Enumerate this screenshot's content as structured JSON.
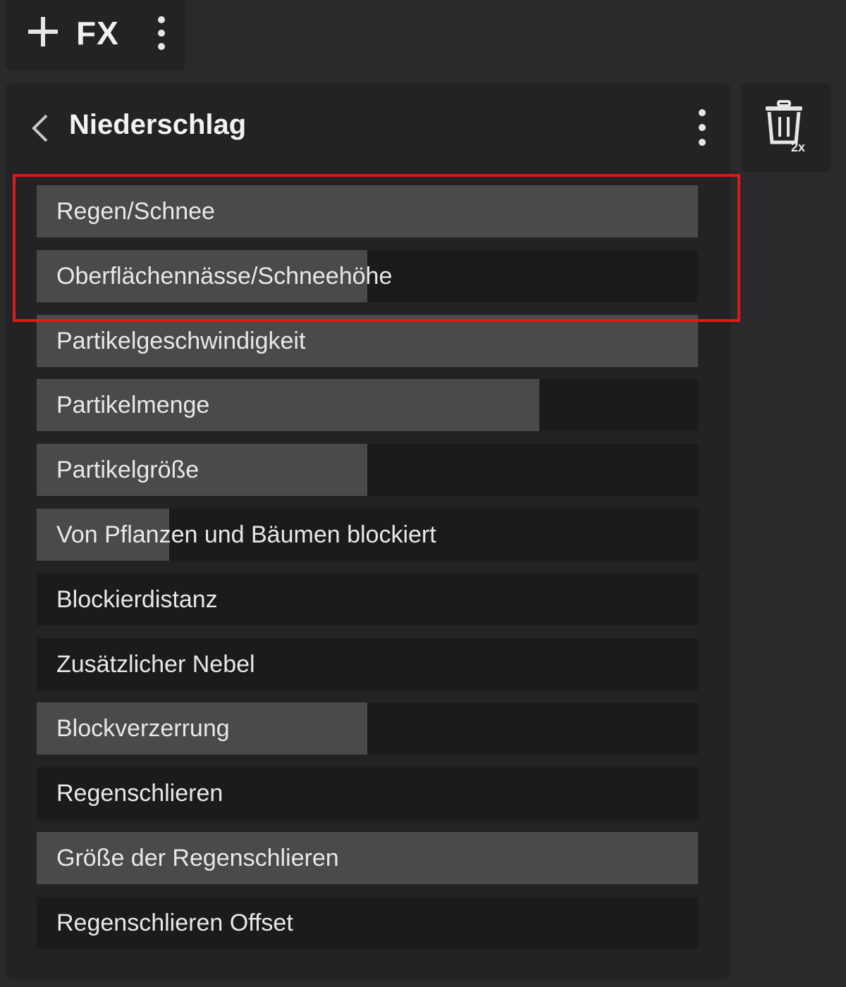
{
  "toolbar": {
    "fx_label": "FX",
    "add_icon": "plus-icon",
    "more_icon": "more-vertical-icon"
  },
  "panel": {
    "title": "Niederschlag",
    "back_icon": "chevron-left-icon",
    "more_icon": "more-vertical-icon"
  },
  "trash": {
    "icon": "trash-icon",
    "badge": "2x"
  },
  "sliders": [
    {
      "label": "Regen/Schnee",
      "fill_pct": 100
    },
    {
      "label": "Oberflächennässe/Schneehöhe",
      "fill_pct": 50
    },
    {
      "label": "Partikelgeschwindigkeit",
      "fill_pct": 100
    },
    {
      "label": "Partikelmenge",
      "fill_pct": 76
    },
    {
      "label": "Partikelgröße",
      "fill_pct": 50
    },
    {
      "label": "Von Pflanzen und Bäumen blockiert",
      "fill_pct": 20
    },
    {
      "label": "Blockierdistanz",
      "fill_pct": 0
    },
    {
      "label": "Zusätzlicher Nebel",
      "fill_pct": 0
    },
    {
      "label": "Blockverzerrung",
      "fill_pct": 50
    },
    {
      "label": "Regenschlieren",
      "fill_pct": 0
    },
    {
      "label": "Größe der Regenschlieren",
      "fill_pct": 100
    },
    {
      "label": "Regenschlieren Offset",
      "fill_pct": 0
    }
  ],
  "colors": {
    "background": "#2a2a2c",
    "panel": "#232325",
    "slider_track": "#1b1b1d",
    "slider_fill": "#4a4a4c",
    "highlight": "#e0191b"
  }
}
